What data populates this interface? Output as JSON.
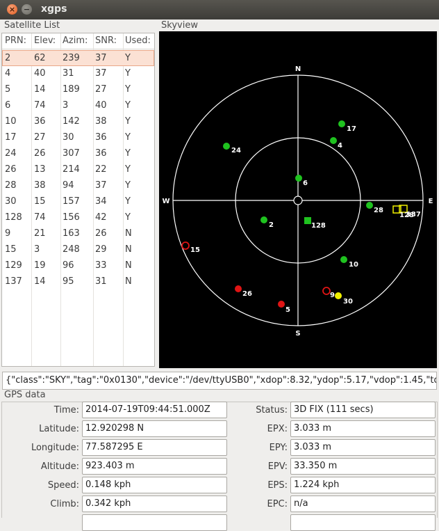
{
  "window": {
    "title": "xgps",
    "close_glyph": "×",
    "min_glyph": "−"
  },
  "satellite_list": {
    "title": "Satellite List",
    "headers": [
      "PRN:",
      "Elev:",
      "Azim:",
      "SNR:",
      "Used:"
    ],
    "rows": [
      [
        "2",
        "62",
        "239",
        "37",
        "Y"
      ],
      [
        "4",
        "40",
        "31",
        "37",
        "Y"
      ],
      [
        "5",
        "14",
        "189",
        "27",
        "Y"
      ],
      [
        "6",
        "74",
        "3",
        "40",
        "Y"
      ],
      [
        "10",
        "36",
        "142",
        "38",
        "Y"
      ],
      [
        "17",
        "27",
        "30",
        "36",
        "Y"
      ],
      [
        "24",
        "26",
        "307",
        "36",
        "Y"
      ],
      [
        "26",
        "13",
        "214",
        "22",
        "Y"
      ],
      [
        "28",
        "38",
        "94",
        "37",
        "Y"
      ],
      [
        "30",
        "15",
        "157",
        "34",
        "Y"
      ],
      [
        "128",
        "74",
        "156",
        "42",
        "Y"
      ],
      [
        "9",
        "21",
        "163",
        "26",
        "N"
      ],
      [
        "15",
        "3",
        "248",
        "29",
        "N"
      ],
      [
        "129",
        "19",
        "96",
        "33",
        "N"
      ],
      [
        "137",
        "14",
        "95",
        "31",
        "N"
      ]
    ],
    "selected_row": 0
  },
  "skyview": {
    "title": "Skyview",
    "compass": {
      "n": "N",
      "s": "S",
      "e": "E",
      "w": "W"
    },
    "colors": {
      "green": "#1fc21f",
      "yellow": "#f0f000",
      "red": "#e01414",
      "ring": "#ffffff"
    },
    "labels": [
      "24",
      "17",
      "4",
      "6",
      "2",
      "128",
      "28",
      "128",
      "137",
      "15",
      "10",
      "26",
      "9",
      "30",
      "5"
    ]
  },
  "json_line": "{\"class\":\"SKY\",\"tag\":\"0x0130\",\"device\":\"/dev/ttyUSB0\",\"xdop\":8.32,\"ydop\":5.17,\"vdop\":1.45,\"tdop\":",
  "gps_data": {
    "title": "GPS data",
    "left": [
      {
        "label": "Time:",
        "value": "2014-07-19T09:44:51.000Z"
      },
      {
        "label": "Latitude:",
        "value": "12.920298 N"
      },
      {
        "label": "Longitude:",
        "value": "77.587295 E"
      },
      {
        "label": "Altitude:",
        "value": "923.403 m"
      },
      {
        "label": "Speed:",
        "value": "0.148 kph"
      },
      {
        "label": "Climb:",
        "value": "0.342 kph"
      }
    ],
    "right": [
      {
        "label": "Status:",
        "value": "3D FIX (111 secs)"
      },
      {
        "label": "EPX:",
        "value": "3.033 m"
      },
      {
        "label": "EPY:",
        "value": "3.033 m"
      },
      {
        "label": "EPV:",
        "value": "33.350 m"
      },
      {
        "label": "EPS:",
        "value": "1.224 kph"
      },
      {
        "label": "EPC:",
        "value": "n/a"
      }
    ]
  }
}
